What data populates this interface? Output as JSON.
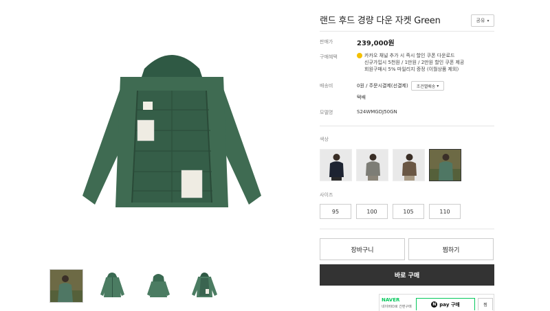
{
  "product": {
    "title": "랜드 후드 경량 다운 자켓 Green",
    "share_label": "공유"
  },
  "info": {
    "price_label": "판매가",
    "price": "239,000원",
    "benefit_label": "구매혜택",
    "benefit_lines": [
      "카카오 채널 추가 시 즉시 할인 쿠폰 다운로드",
      "신규가입시 5천원 / 1만원 / 2만원 할인 쿠폰 제공",
      "회원구매시 5% 마일리지 증정 (이월상품 제외)"
    ],
    "shipping_label": "배송비",
    "shipping_value": "0원  / 주문시결제(선결제)",
    "shipping_condition_button": "조건별배송",
    "shipping_method": "택배",
    "model_label": "모델명",
    "model_value": "S24WMGDJ50GN"
  },
  "options": {
    "color_label": "색상",
    "color_swatches": [
      "navy-jacket-swatch",
      "gray-jacket-swatch",
      "brown-jacket-swatch",
      "green-jacket-swatch"
    ],
    "selected_color_index": 3,
    "size_label": "사이즈",
    "sizes": [
      "95",
      "100",
      "105",
      "110"
    ]
  },
  "actions": {
    "cart": "장바구니",
    "wishlist": "찜하기",
    "buy_now": "바로 구매"
  },
  "naver": {
    "logo": "NAVER",
    "sub": "네이버ID로 간편구매",
    "npay_label": "pay 구매",
    "npay_n": "N",
    "zzim_label": "찜"
  },
  "colors": {
    "jacket_green": "#3f6b52",
    "buy_button": "#333333",
    "naver_green": "#03c75a",
    "kakao_yellow": "#f4c000"
  }
}
